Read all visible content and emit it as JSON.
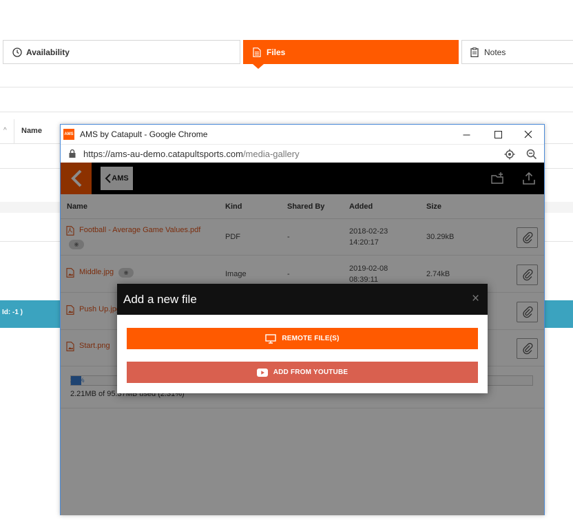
{
  "tabs": {
    "availability": "Availability",
    "files": "Files",
    "notes": "Notes"
  },
  "background": {
    "grid_name_header": "Name",
    "selected_row_text": "Id: -1 )"
  },
  "window": {
    "title": "AMS by Catapult - Google Chrome",
    "favicon_text": "AMS",
    "url_host": "https://ams-au-demo.catapultsports.com",
    "url_path": "/media-gallery"
  },
  "app": {
    "logo_text": "AMS",
    "columns": {
      "name": "Name",
      "kind": "Kind",
      "shared_by": "Shared By",
      "added": "Added",
      "size": "Size"
    },
    "files": [
      {
        "name": "Football - Average Game Values.pdf",
        "kind": "PDF",
        "shared_by": "-",
        "added_date": "2018-02-23",
        "added_time": "14:20:17",
        "size": "30.29kB"
      },
      {
        "name": "Middle.jpg",
        "kind": "Image",
        "shared_by": "-",
        "added_date": "2019-02-08",
        "added_time": "08:39:11",
        "size": "2.74kB"
      },
      {
        "name": "Push Up.jpg",
        "kind": "",
        "shared_by": "",
        "added_date": "",
        "added_time": "",
        "size": ""
      },
      {
        "name": "Start.png",
        "kind": "",
        "shared_by": "",
        "added_date": "",
        "added_time": "",
        "size": ""
      }
    ],
    "usage": {
      "percent_label": "2.3%",
      "percent_value": 2.3,
      "summary": "2.21MB of 95.37MB used (2.31%)"
    }
  },
  "modal": {
    "title": "Add a new file",
    "close_glyph": "×",
    "remote_button": "REMOTE FILE(S)",
    "youtube_button": "ADD FROM YOUTUBE"
  },
  "colors": {
    "accent": "#ff5a00",
    "youtube_button": "#d9604f",
    "selected_row": "#3ba3bf",
    "window_border": "#4a8ad8"
  }
}
